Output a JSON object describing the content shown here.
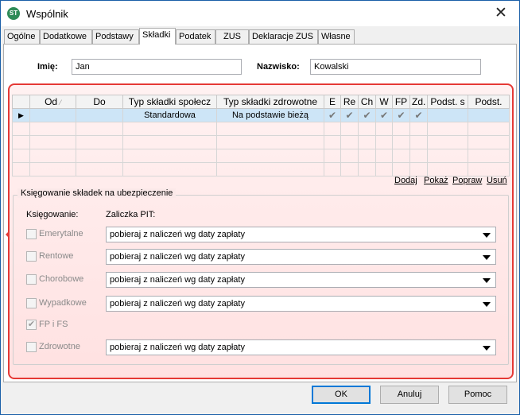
{
  "window": {
    "title": "Wspólnik",
    "icon": "app-logo-icon"
  },
  "tabs": [
    "Ogólne",
    "Dodatkowe",
    "Podstawy",
    "Składki",
    "Podatek",
    "ZUS",
    "Deklaracje ZUS",
    "Własne"
  ],
  "active_tab": "Składki",
  "person": {
    "first_name_label": "Imię:",
    "first_name_value": "Jan",
    "last_name_label": "Nazwisko:",
    "last_name_value": "Kowalski"
  },
  "grid": {
    "columns": [
      "Od",
      "Do",
      "Typ składki społecz",
      "Typ składki zdrowotne",
      "E",
      "Re",
      "Ch",
      "W",
      "FP",
      "Zd.",
      "Podst. s",
      "Podst."
    ],
    "rows": [
      {
        "od": "",
        "do": "",
        "spoleczne": "Standardowa",
        "zdrowotne": "Na podstawie bieżą",
        "e": true,
        "re": true,
        "ch": true,
        "w": true,
        "fp": true,
        "zd": true,
        "podst_s": "",
        "podst": ""
      }
    ],
    "empty_rows": 4
  },
  "actions": {
    "add": "Dodaj",
    "show": "Pokaż",
    "edit": "Popraw",
    "delete": "Usuń"
  },
  "booking": {
    "legend": "Księgowanie składek na ubezpieczenie",
    "col_booking": "Księgowanie:",
    "col_pit": "Zaliczka PIT:",
    "rows": [
      {
        "label": "Emerytalne",
        "checked": false,
        "select": "pobieraj z naliczeń wg daty zapłaty"
      },
      {
        "label": "Rentowe",
        "checked": false,
        "select": "pobieraj z naliczeń wg daty zapłaty"
      },
      {
        "label": "Chorobowe",
        "checked": false,
        "select": "pobieraj z naliczeń wg daty zapłaty"
      },
      {
        "label": "Wypadkowe",
        "checked": false,
        "select": "pobieraj z naliczeń wg daty zapłaty"
      },
      {
        "label": "FP i FS",
        "checked": true,
        "select": ""
      },
      {
        "label": "Zdrowotne",
        "checked": false,
        "select": "pobieraj z naliczeń wg daty zapłaty"
      }
    ]
  },
  "buttons": {
    "ok": "OK",
    "cancel": "Anuluj",
    "help": "Pomoc"
  },
  "colors": {
    "highlight_border": "#e53935",
    "selection": "#cde5f7",
    "title_border": "#1a5fa8"
  }
}
